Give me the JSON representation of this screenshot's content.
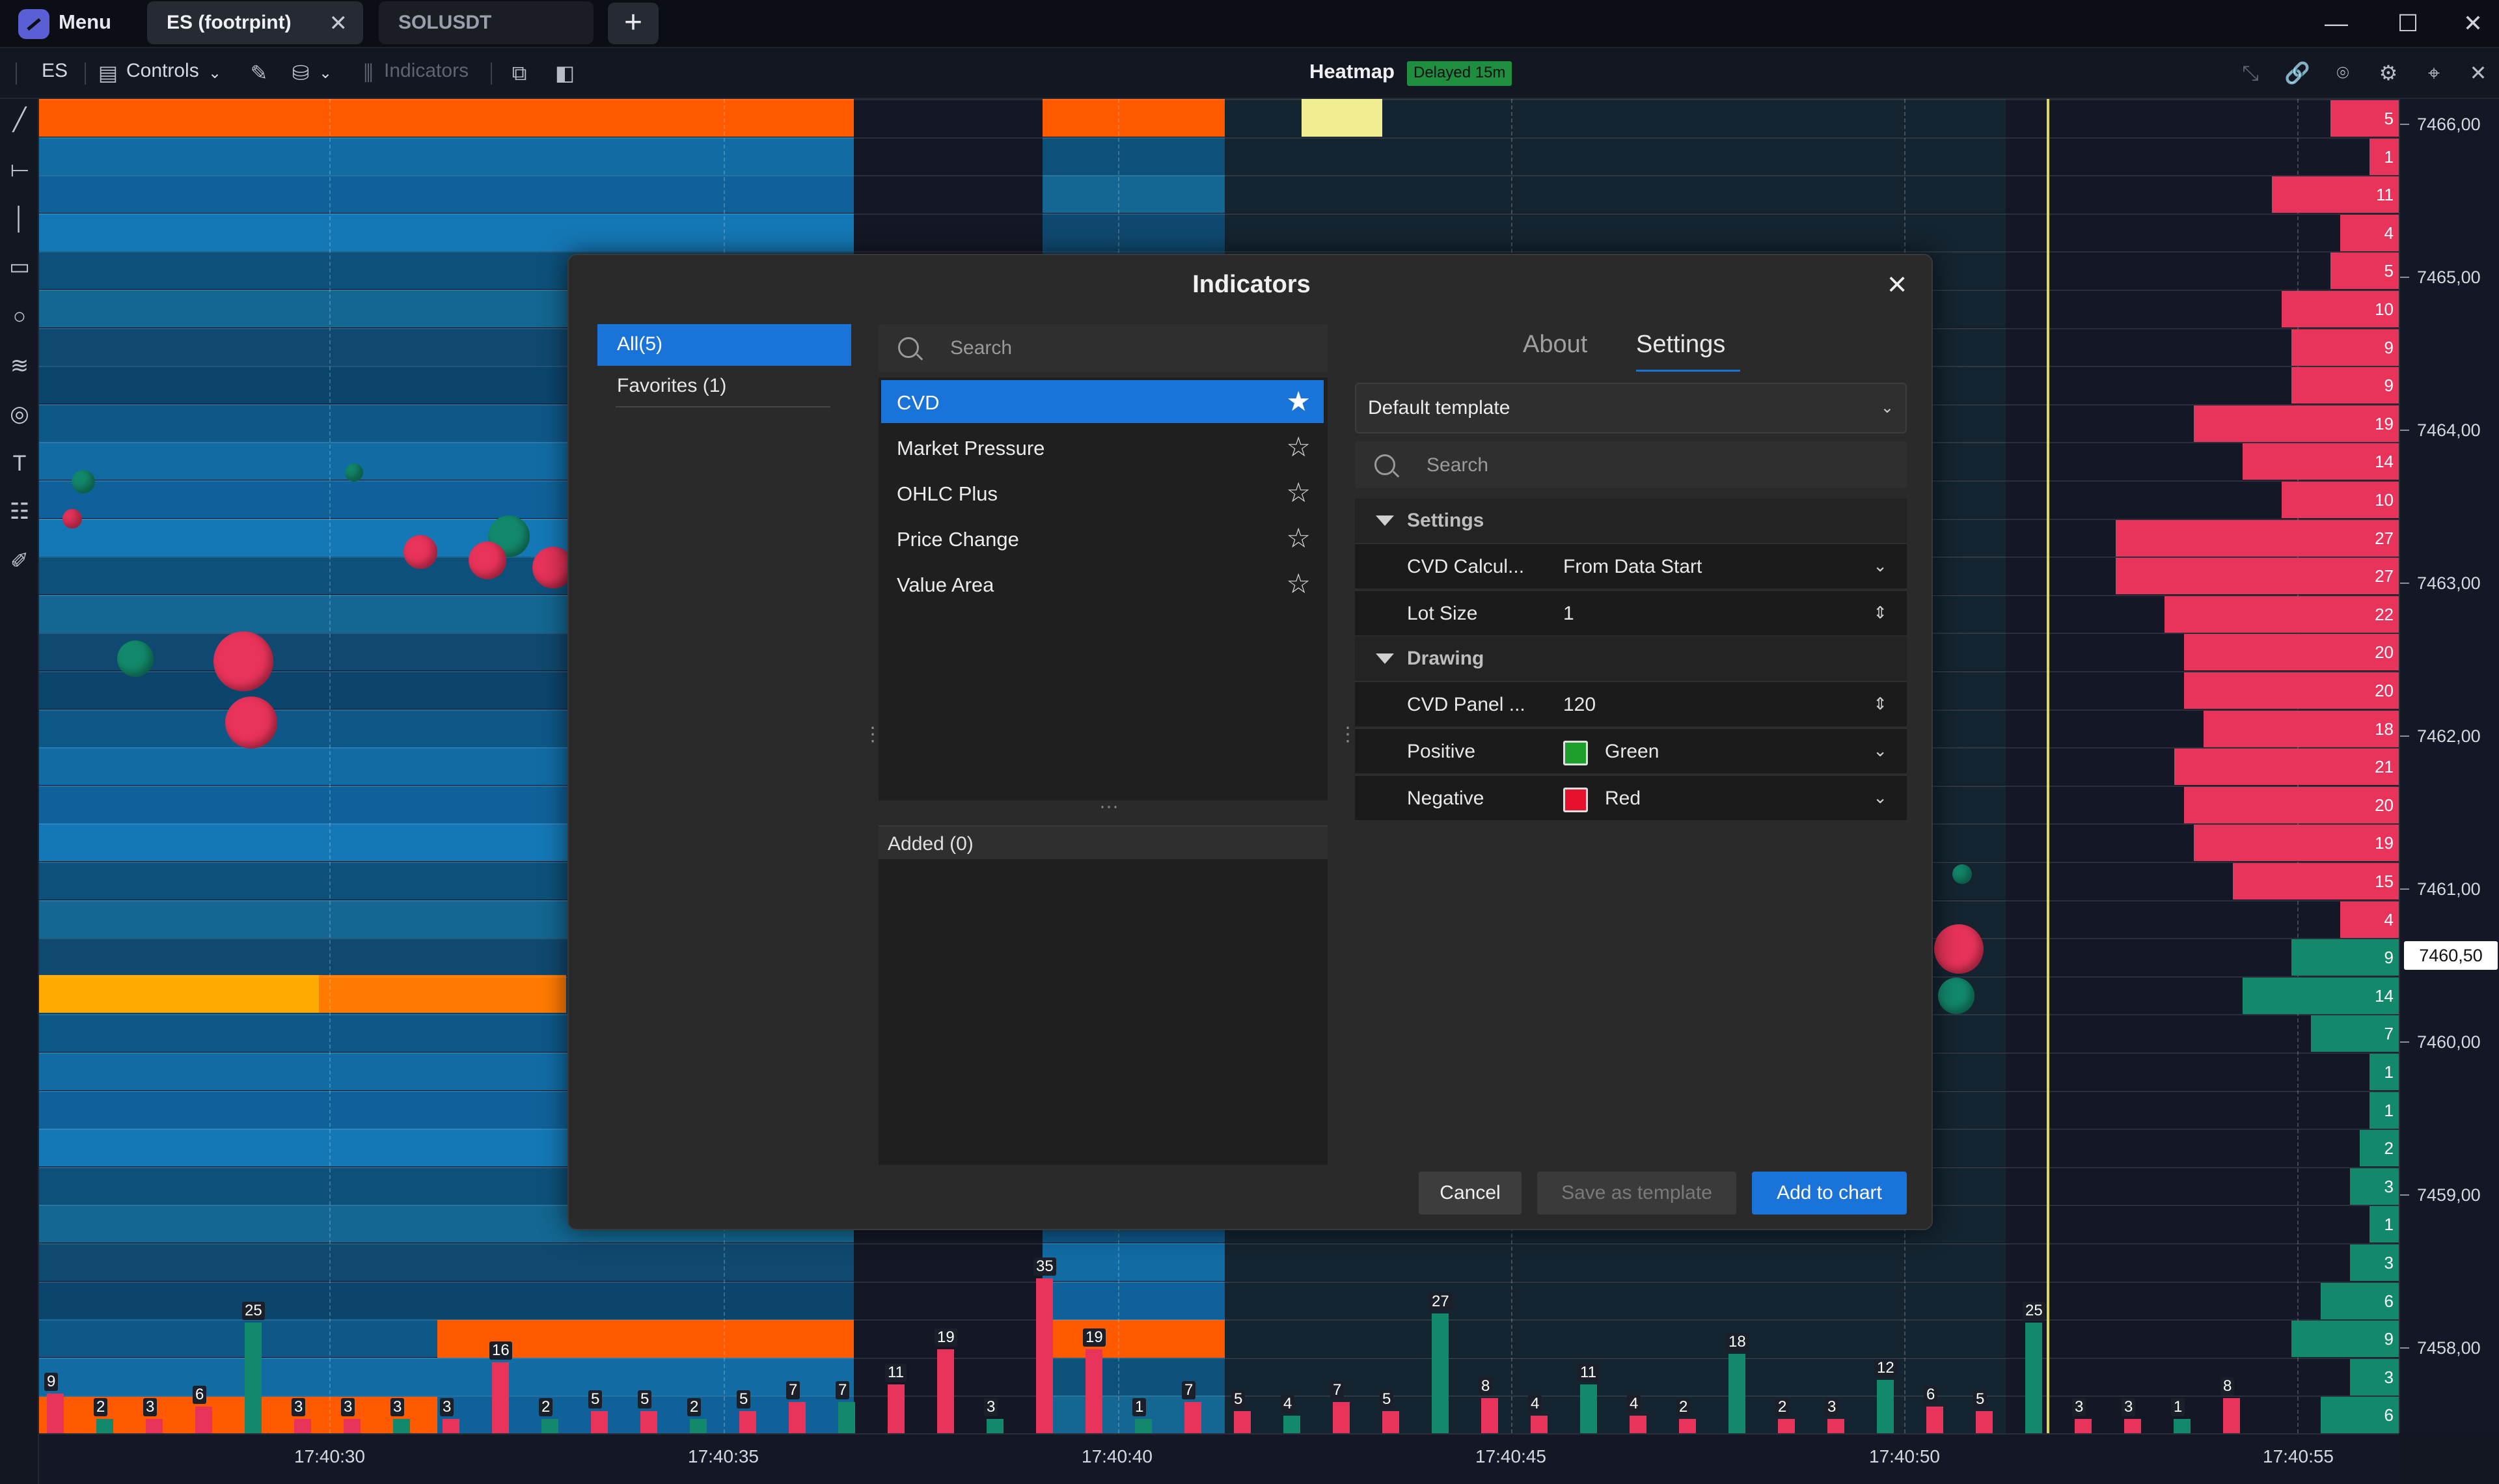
{
  "titlebar": {
    "menu_label": "Menu",
    "tabs": [
      {
        "label": "ES (footrpint)",
        "active": true
      },
      {
        "label": "SOLUSDT",
        "active": false
      }
    ],
    "new_tab_label": "+",
    "window": {
      "minimize": "—",
      "maximize": "☐",
      "close": "✕"
    }
  },
  "toolbar": {
    "symbol": "ES",
    "controls_label": "Controls",
    "indicators_label": "Indicators",
    "chart_title": "Heatmap",
    "delayed_badge": "Delayed 15m"
  },
  "chart": {
    "prices": [
      "7466,00",
      "7465,00",
      "7464,00",
      "7463,00",
      "7462,00",
      "7461,00",
      "7460,00",
      "7459,00",
      "7458,00"
    ],
    "current_price": "7460,50",
    "times": [
      "17:40:30",
      "17:40:35",
      "17:40:40",
      "17:40:45",
      "17:40:50",
      "17:40:55"
    ],
    "profile_counts": [
      "5",
      "1",
      "11",
      "4",
      "5",
      "10",
      "9",
      "9",
      "19",
      "14",
      "10",
      "27",
      "27",
      "22",
      "20",
      "20",
      "18",
      "21",
      "20",
      "19",
      "15",
      "4",
      "9",
      "14",
      "7",
      "1",
      "1",
      "2",
      "3",
      "1",
      "3",
      "6",
      "9",
      "3",
      "6"
    ],
    "volume_labels": [
      "9",
      "2",
      "3",
      "6",
      "25",
      "3",
      "3",
      "3",
      "3",
      "16",
      "2",
      "5",
      "5",
      "2",
      "5",
      "7",
      "7",
      "11",
      "19",
      "3",
      "35",
      "19",
      "1",
      "7",
      "5",
      "4",
      "7",
      "5",
      "27",
      "8",
      "4",
      "11",
      "4",
      "2",
      "18",
      "2",
      "3",
      "12",
      "6",
      "5",
      "25",
      "3",
      "3",
      "1",
      "8"
    ],
    "colors": {
      "bid": "#e8335a",
      "ask": "#13896b",
      "current_time_line": "#e0d84a"
    }
  },
  "modal": {
    "title": "Indicators",
    "categories": [
      {
        "label": "All",
        "count": "(5)"
      },
      {
        "label": "Favorites",
        "count": "(1)"
      }
    ],
    "search_placeholder": "Search",
    "indicators": [
      {
        "label": "CVD",
        "favorite": true
      },
      {
        "label": "Market Pressure",
        "favorite": false
      },
      {
        "label": "OHLC Plus",
        "favorite": false
      },
      {
        "label": "Price Change",
        "favorite": false
      },
      {
        "label": "Value Area",
        "favorite": false
      }
    ],
    "added_label": "Added (0)",
    "tabs": {
      "about": "About",
      "settings": "Settings"
    },
    "template": "Default template",
    "settings_search_placeholder": "Search",
    "sections": {
      "settings": "Settings",
      "drawing": "Drawing"
    },
    "fields": {
      "cvd_calc_label": "CVD Calcul...",
      "cvd_calc_value": "From Data Start",
      "lot_size_label": "Lot Size",
      "lot_size_value": "1",
      "cvd_panel_label": "CVD Panel ...",
      "cvd_panel_value": "120",
      "positive_label": "Positive",
      "positive_value": "Green",
      "positive_color": "#1e9e2a",
      "negative_label": "Negative",
      "negative_value": "Red",
      "negative_color": "#e8112b"
    },
    "buttons": {
      "cancel": "Cancel",
      "save_template": "Save as template",
      "add_to_chart": "Add to chart"
    }
  }
}
